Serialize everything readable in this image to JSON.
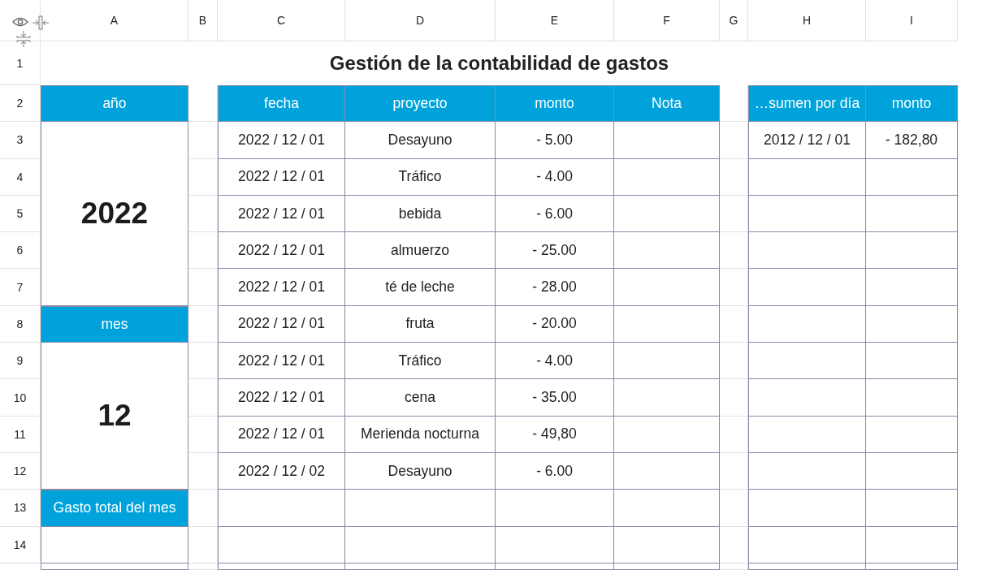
{
  "column_headers": [
    "A",
    "B",
    "C",
    "D",
    "E",
    "F",
    "G",
    "H",
    "I"
  ],
  "row_numbers": [
    "1",
    "2",
    "3",
    "4",
    "5",
    "6",
    "7",
    "8",
    "9",
    "10",
    "11",
    "12",
    "13",
    "14"
  ],
  "title": "Gestión de la contabilidad de gastos",
  "year": {
    "label": "año",
    "value": "2022"
  },
  "month": {
    "label": "mes",
    "value": "12"
  },
  "total": {
    "label": "Gasto total del mes"
  },
  "expenses": {
    "columns": [
      "fecha",
      "proyecto",
      "monto",
      "Nota"
    ],
    "rows": [
      {
        "fecha": "2022 / 12 / 01",
        "proyecto": "Desayuno",
        "monto": "- 5.00"
      },
      {
        "fecha": "2022 / 12 / 01",
        "proyecto": "Tráfico",
        "monto": "- 4.00"
      },
      {
        "fecha": "2022 / 12 / 01",
        "proyecto": "bebida",
        "monto": "- 6.00"
      },
      {
        "fecha": "2022 / 12 / 01",
        "proyecto": "almuerzo",
        "monto": "- 25.00"
      },
      {
        "fecha": "2022 / 12 / 01",
        "proyecto": "té de leche",
        "monto": "- 28.00"
      },
      {
        "fecha": "2022 / 12 / 01",
        "proyecto": "fruta",
        "monto": "- 20.00"
      },
      {
        "fecha": "2022 / 12 / 01",
        "proyecto": "Tráfico",
        "monto": "- 4.00"
      },
      {
        "fecha": "2022 / 12 / 01",
        "proyecto": "cena",
        "monto": "- 35.00"
      },
      {
        "fecha": "2022 / 12 / 01",
        "proyecto": "Merienda nocturna",
        "monto": "- 49,80"
      },
      {
        "fecha": "2022 / 12 / 02",
        "proyecto": "Desayuno",
        "monto": "- 6.00"
      }
    ]
  },
  "summary": {
    "columns": [
      "…sumen por día",
      "monto"
    ],
    "rows": [
      {
        "fecha": "2012 / 12 / 01",
        "monto": "- 182,80"
      }
    ]
  }
}
